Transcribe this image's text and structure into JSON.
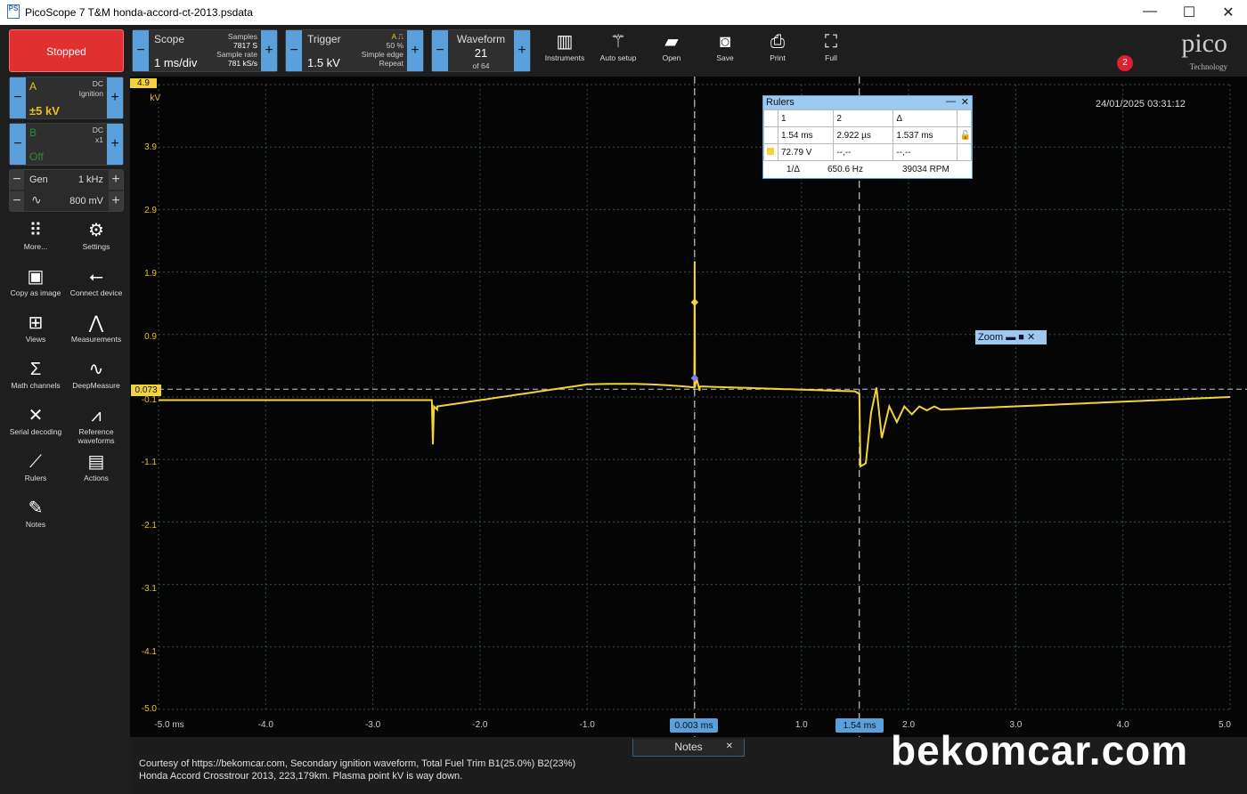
{
  "window": {
    "title": "PicoScope 7 T&M honda-accord-ct-2013.psdata"
  },
  "toolbar": {
    "stopped": "Stopped",
    "scope": {
      "label": "Scope",
      "value": "1 ms/div",
      "samples_label": "Samples",
      "samples": "7817 S",
      "rate_label": "Sample rate",
      "rate": "781 kS/s"
    },
    "trigger": {
      "label": "Trigger",
      "value": "1.5 kV",
      "channel": "A",
      "percent": "50 %",
      "type": "Simple edge",
      "mode": "Repeat"
    },
    "waveform": {
      "label": "Waveform",
      "value": "21",
      "of": "of 64"
    },
    "buttons": [
      "Instruments",
      "Auto setup",
      "Open",
      "Save",
      "Print",
      "Full"
    ],
    "logo": "pico",
    "logo_sub": "Technology",
    "badge": "2"
  },
  "channels": {
    "a": {
      "letter": "A",
      "coupling": "DC",
      "probe": "Ignition",
      "range": "±5 kV"
    },
    "b": {
      "letter": "B",
      "coupling": "DC",
      "probe": "x1",
      "range": "Off"
    },
    "gen": {
      "label": "Gen",
      "freq": "1 kHz",
      "amp": "800 mV"
    }
  },
  "sidebar": [
    {
      "label": "More...",
      "icon": "grid-icon",
      "glyph": "⠿"
    },
    {
      "label": "Settings",
      "icon": "gear-icon",
      "glyph": "⚙"
    },
    {
      "label": "Copy as image",
      "icon": "image-icon",
      "glyph": "▣"
    },
    {
      "label": "Connect device",
      "icon": "usb-icon",
      "glyph": "⭠"
    },
    {
      "label": "Views",
      "icon": "views-icon",
      "glyph": "⊞"
    },
    {
      "label": "Measurements",
      "icon": "compass-icon",
      "glyph": "⋀"
    },
    {
      "label": "Math channels",
      "icon": "sigma-icon",
      "glyph": "Σ"
    },
    {
      "label": "DeepMeasure",
      "icon": "wave-icon",
      "glyph": "∿"
    },
    {
      "label": "Serial decoding",
      "icon": "serial-icon",
      "glyph": "✕"
    },
    {
      "label": "Reference waveforms",
      "icon": "reference-icon",
      "glyph": "⩘"
    },
    {
      "label": "Rulers",
      "icon": "ruler-icon",
      "glyph": "⟋"
    },
    {
      "label": "Actions",
      "icon": "clapper-icon",
      "glyph": "▤"
    },
    {
      "label": "Notes",
      "icon": "notes-icon",
      "glyph": "✎"
    }
  ],
  "plot": {
    "timestamp": "24/01/2025 03:31:12",
    "unit": "kV",
    "top_value": "4.9",
    "trigger_level": "0.073",
    "y_ticks": [
      "3.9",
      "2.9",
      "1.9",
      "0.9",
      "-0.1",
      "-1.1",
      "-2.1",
      "-3.1",
      "-4.1",
      "-5.0"
    ],
    "x_ticks": [
      "-5.0 ms",
      "-4.0",
      "-3.0",
      "-2.0",
      "-1.0",
      "1.0",
      "2.0",
      "3.0",
      "4.0",
      "5.0"
    ],
    "ruler1": "0.003 ms",
    "ruler2": "1.54 ms",
    "colors": {
      "trace": "#f2d33a",
      "grid": "#2e4f57",
      "ruler": "#5aa0dc"
    }
  },
  "rulers_panel": {
    "title": "Rulers",
    "headers": [
      "1",
      "2",
      "Δ"
    ],
    "time_row": [
      "1.54 ms",
      "2.922 µs",
      "1.537 ms"
    ],
    "volt_row": [
      "72.79 V",
      "--,--",
      "--,--"
    ],
    "freq_label": "1/Δ",
    "freq": "650.6 Hz",
    "rpm": "39034 RPM"
  },
  "zoom": {
    "label": "Zoom"
  },
  "notes": {
    "tab": "Notes",
    "line1": "Courtesy of https://bekomcar.com, Secondary ignition waveform, Total Fuel Trim B1(25.0%) B2(23%)",
    "line2": "Honda Accord Crosstrour 2013, 223,179km. Plasma point kV is way down."
  },
  "watermark": "bekomcar.com"
}
